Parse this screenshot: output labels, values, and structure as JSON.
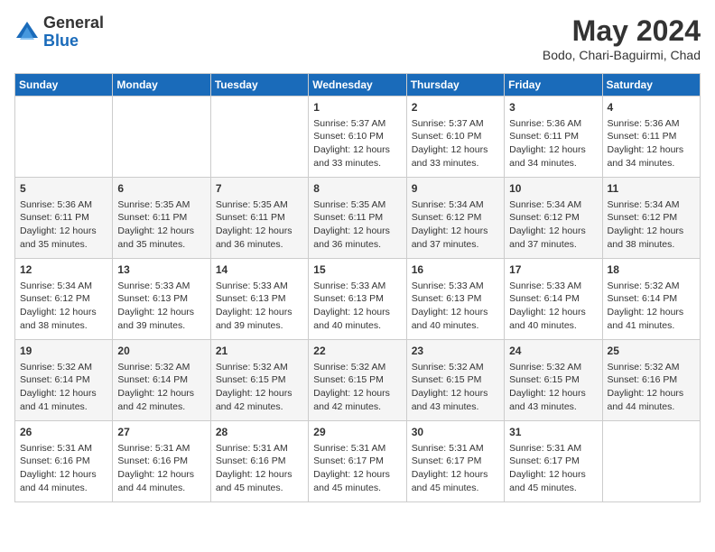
{
  "logo": {
    "general": "General",
    "blue": "Blue"
  },
  "title": {
    "month_year": "May 2024",
    "location": "Bodo, Chari-Baguirmi, Chad"
  },
  "weekdays": [
    "Sunday",
    "Monday",
    "Tuesday",
    "Wednesday",
    "Thursday",
    "Friday",
    "Saturday"
  ],
  "weeks": [
    [
      {
        "day": "",
        "info": ""
      },
      {
        "day": "",
        "info": ""
      },
      {
        "day": "",
        "info": ""
      },
      {
        "day": "1",
        "sunrise": "Sunrise: 5:37 AM",
        "sunset": "Sunset: 6:10 PM",
        "daylight": "Daylight: 12 hours and 33 minutes."
      },
      {
        "day": "2",
        "sunrise": "Sunrise: 5:37 AM",
        "sunset": "Sunset: 6:10 PM",
        "daylight": "Daylight: 12 hours and 33 minutes."
      },
      {
        "day": "3",
        "sunrise": "Sunrise: 5:36 AM",
        "sunset": "Sunset: 6:11 PM",
        "daylight": "Daylight: 12 hours and 34 minutes."
      },
      {
        "day": "4",
        "sunrise": "Sunrise: 5:36 AM",
        "sunset": "Sunset: 6:11 PM",
        "daylight": "Daylight: 12 hours and 34 minutes."
      }
    ],
    [
      {
        "day": "5",
        "sunrise": "Sunrise: 5:36 AM",
        "sunset": "Sunset: 6:11 PM",
        "daylight": "Daylight: 12 hours and 35 minutes."
      },
      {
        "day": "6",
        "sunrise": "Sunrise: 5:35 AM",
        "sunset": "Sunset: 6:11 PM",
        "daylight": "Daylight: 12 hours and 35 minutes."
      },
      {
        "day": "7",
        "sunrise": "Sunrise: 5:35 AM",
        "sunset": "Sunset: 6:11 PM",
        "daylight": "Daylight: 12 hours and 36 minutes."
      },
      {
        "day": "8",
        "sunrise": "Sunrise: 5:35 AM",
        "sunset": "Sunset: 6:11 PM",
        "daylight": "Daylight: 12 hours and 36 minutes."
      },
      {
        "day": "9",
        "sunrise": "Sunrise: 5:34 AM",
        "sunset": "Sunset: 6:12 PM",
        "daylight": "Daylight: 12 hours and 37 minutes."
      },
      {
        "day": "10",
        "sunrise": "Sunrise: 5:34 AM",
        "sunset": "Sunset: 6:12 PM",
        "daylight": "Daylight: 12 hours and 37 minutes."
      },
      {
        "day": "11",
        "sunrise": "Sunrise: 5:34 AM",
        "sunset": "Sunset: 6:12 PM",
        "daylight": "Daylight: 12 hours and 38 minutes."
      }
    ],
    [
      {
        "day": "12",
        "sunrise": "Sunrise: 5:34 AM",
        "sunset": "Sunset: 6:12 PM",
        "daylight": "Daylight: 12 hours and 38 minutes."
      },
      {
        "day": "13",
        "sunrise": "Sunrise: 5:33 AM",
        "sunset": "Sunset: 6:13 PM",
        "daylight": "Daylight: 12 hours and 39 minutes."
      },
      {
        "day": "14",
        "sunrise": "Sunrise: 5:33 AM",
        "sunset": "Sunset: 6:13 PM",
        "daylight": "Daylight: 12 hours and 39 minutes."
      },
      {
        "day": "15",
        "sunrise": "Sunrise: 5:33 AM",
        "sunset": "Sunset: 6:13 PM",
        "daylight": "Daylight: 12 hours and 40 minutes."
      },
      {
        "day": "16",
        "sunrise": "Sunrise: 5:33 AM",
        "sunset": "Sunset: 6:13 PM",
        "daylight": "Daylight: 12 hours and 40 minutes."
      },
      {
        "day": "17",
        "sunrise": "Sunrise: 5:33 AM",
        "sunset": "Sunset: 6:14 PM",
        "daylight": "Daylight: 12 hours and 40 minutes."
      },
      {
        "day": "18",
        "sunrise": "Sunrise: 5:32 AM",
        "sunset": "Sunset: 6:14 PM",
        "daylight": "Daylight: 12 hours and 41 minutes."
      }
    ],
    [
      {
        "day": "19",
        "sunrise": "Sunrise: 5:32 AM",
        "sunset": "Sunset: 6:14 PM",
        "daylight": "Daylight: 12 hours and 41 minutes."
      },
      {
        "day": "20",
        "sunrise": "Sunrise: 5:32 AM",
        "sunset": "Sunset: 6:14 PM",
        "daylight": "Daylight: 12 hours and 42 minutes."
      },
      {
        "day": "21",
        "sunrise": "Sunrise: 5:32 AM",
        "sunset": "Sunset: 6:15 PM",
        "daylight": "Daylight: 12 hours and 42 minutes."
      },
      {
        "day": "22",
        "sunrise": "Sunrise: 5:32 AM",
        "sunset": "Sunset: 6:15 PM",
        "daylight": "Daylight: 12 hours and 42 minutes."
      },
      {
        "day": "23",
        "sunrise": "Sunrise: 5:32 AM",
        "sunset": "Sunset: 6:15 PM",
        "daylight": "Daylight: 12 hours and 43 minutes."
      },
      {
        "day": "24",
        "sunrise": "Sunrise: 5:32 AM",
        "sunset": "Sunset: 6:15 PM",
        "daylight": "Daylight: 12 hours and 43 minutes."
      },
      {
        "day": "25",
        "sunrise": "Sunrise: 5:32 AM",
        "sunset": "Sunset: 6:16 PM",
        "daylight": "Daylight: 12 hours and 44 minutes."
      }
    ],
    [
      {
        "day": "26",
        "sunrise": "Sunrise: 5:31 AM",
        "sunset": "Sunset: 6:16 PM",
        "daylight": "Daylight: 12 hours and 44 minutes."
      },
      {
        "day": "27",
        "sunrise": "Sunrise: 5:31 AM",
        "sunset": "Sunset: 6:16 PM",
        "daylight": "Daylight: 12 hours and 44 minutes."
      },
      {
        "day": "28",
        "sunrise": "Sunrise: 5:31 AM",
        "sunset": "Sunset: 6:16 PM",
        "daylight": "Daylight: 12 hours and 45 minutes."
      },
      {
        "day": "29",
        "sunrise": "Sunrise: 5:31 AM",
        "sunset": "Sunset: 6:17 PM",
        "daylight": "Daylight: 12 hours and 45 minutes."
      },
      {
        "day": "30",
        "sunrise": "Sunrise: 5:31 AM",
        "sunset": "Sunset: 6:17 PM",
        "daylight": "Daylight: 12 hours and 45 minutes."
      },
      {
        "day": "31",
        "sunrise": "Sunrise: 5:31 AM",
        "sunset": "Sunset: 6:17 PM",
        "daylight": "Daylight: 12 hours and 45 minutes."
      },
      {
        "day": "",
        "info": ""
      }
    ]
  ]
}
